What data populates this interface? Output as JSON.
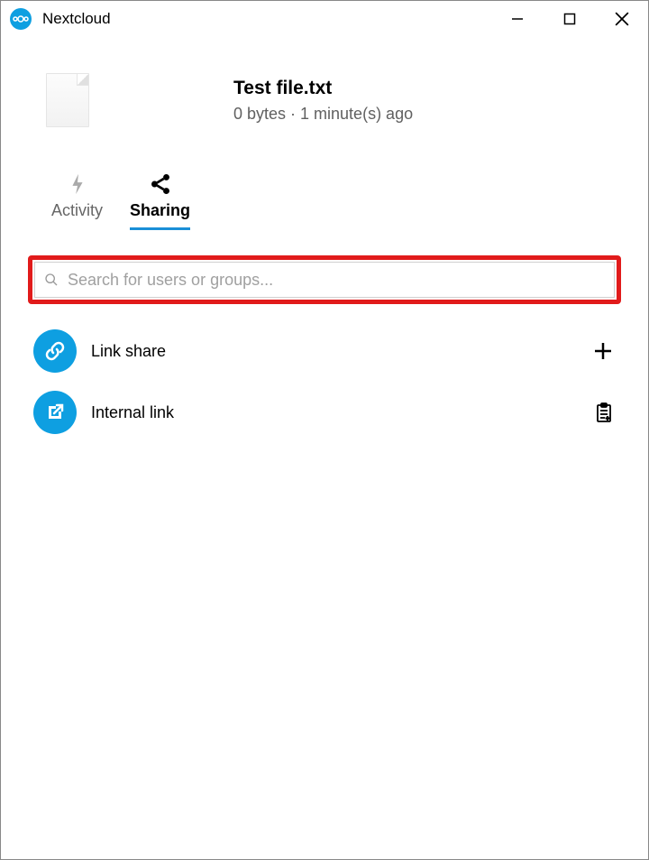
{
  "window": {
    "title": "Nextcloud"
  },
  "file": {
    "name": "Test file.txt",
    "meta": "0 bytes · 1 minute(s) ago"
  },
  "tabs": {
    "activity": "Activity",
    "sharing": "Sharing"
  },
  "search": {
    "placeholder": "Search for users or groups..."
  },
  "share": {
    "link": "Link share",
    "internal": "Internal link"
  }
}
